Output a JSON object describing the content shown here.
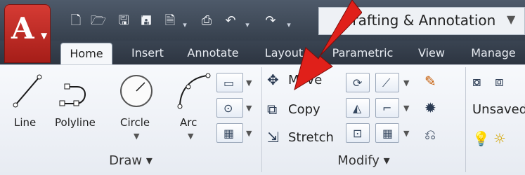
{
  "workspace": {
    "name": "Drafting & Annotation"
  },
  "ribbon": {
    "tabs": [
      "Home",
      "Insert",
      "Annotate",
      "Layout",
      "Parametric",
      "View",
      "Manage"
    ]
  },
  "panels": {
    "draw": {
      "title": "Draw ▾",
      "tools": [
        "Line",
        "Polyline",
        "Circle",
        "Arc"
      ]
    },
    "modify": {
      "title": "Modify ▾",
      "commands": [
        "Move",
        "Copy",
        "Stretch"
      ]
    },
    "right": {
      "unsaved_label": "Unsaved"
    }
  },
  "icons": {
    "app_menu": "app-menu-icon",
    "qat": [
      "new-icon",
      "open-icon",
      "save-icon",
      "save-as-icon",
      "plot-icon",
      "undo-icon",
      "redo-icon"
    ],
    "pointer": "red-arrow-pointer"
  },
  "colors": {
    "accent_red": "#e0201a",
    "title_bg": "#4e5a6a",
    "ribbon_bg": "#3a4452",
    "panel_bg": "#f7f9fc"
  }
}
